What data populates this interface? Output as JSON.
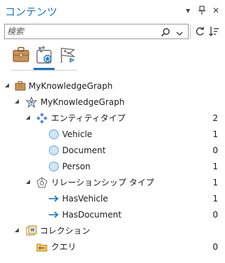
{
  "window": {
    "title": "コンテンツ",
    "controls": {
      "menu": "▾",
      "pin": "🖈",
      "close": "✕"
    }
  },
  "search": {
    "placeholder": "検索",
    "value": ""
  },
  "tabs": [
    {
      "icon": "briefcase-icon",
      "selected": false
    },
    {
      "icon": "graph-list-icon",
      "selected": true
    },
    {
      "icon": "graph-flag-icon",
      "selected": false
    }
  ],
  "tree": [
    {
      "label": "MyKnowledgeGraph",
      "count": "",
      "icon": "briefcase-icon"
    },
    {
      "label": "MyKnowledgeGraph",
      "count": "",
      "icon": "network-star-icon"
    },
    {
      "label": "エンティティタイプ",
      "count": "2",
      "icon": "entity-types-icon"
    },
    {
      "label": "Vehicle",
      "count": "1",
      "icon": "entity-circle-icon"
    },
    {
      "label": "Document",
      "count": "0",
      "icon": "entity-circle-icon"
    },
    {
      "label": "Person",
      "count": "1",
      "icon": "entity-circle-icon"
    },
    {
      "label": "リレーションシップ タイプ",
      "count": "1",
      "icon": "relationship-types-icon"
    },
    {
      "label": "HasVehicle",
      "count": "1",
      "icon": "arrow-right-icon"
    },
    {
      "label": "HasDocument",
      "count": "0",
      "icon": "arrow-right-icon"
    },
    {
      "label": "コレクション",
      "count": "",
      "icon": "collection-icon"
    },
    {
      "label": "クエリ",
      "count": "0",
      "icon": "query-folder-icon"
    }
  ],
  "colors": {
    "accent": "#1e73be",
    "briefcase": "#b07a3e",
    "entity": "#cfe6fa"
  }
}
